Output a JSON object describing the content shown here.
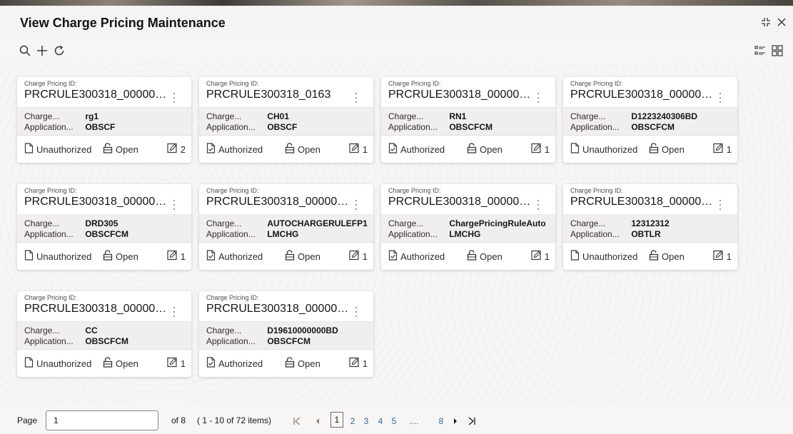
{
  "header": {
    "title": "View Charge Pricing Maintenance",
    "minimize_icon": "compress-icon",
    "close_icon": "close-icon"
  },
  "toolbar": {
    "icons": [
      "search-icon",
      "add-icon",
      "refresh-icon"
    ],
    "view_icons": [
      "list-view-icon",
      "tile-view-icon"
    ]
  },
  "card_labels": {
    "id_label": "Charge Pricing ID:",
    "charge_key": "Charge...",
    "application_key": "Application..."
  },
  "cards": [
    {
      "id": "PRCRULE300318_000000...",
      "charge": "rg1",
      "application": "OBSCF",
      "status": "Unauthorized",
      "lock": "Open",
      "mods": "2"
    },
    {
      "id": "PRCRULE300318_0163",
      "charge": "CH01",
      "application": "OBSCF",
      "status": "Authorized",
      "lock": "Open",
      "mods": "1"
    },
    {
      "id": "PRCRULE300318_000000...",
      "charge": "RN1",
      "application": "OBSCFCM",
      "status": "Authorized",
      "lock": "Open",
      "mods": "1"
    },
    {
      "id": "PRCRULE300318_000000...",
      "charge": "D1223240306BD",
      "application": "OBSCFCM",
      "status": "Unauthorized",
      "lock": "Open",
      "mods": "1"
    },
    {
      "id": "PRCRULE300318_000000...",
      "charge": "DRD305",
      "application": "OBSCFCM",
      "status": "Unauthorized",
      "lock": "Open",
      "mods": "1"
    },
    {
      "id": "PRCRULE300318_000000...",
      "charge": "AUTOCHARGERULEFP1",
      "application": "LMCHG",
      "status": "Authorized",
      "lock": "Open",
      "mods": "1"
    },
    {
      "id": "PRCRULE300318_000000...",
      "charge": "ChargePricingRuleAuto",
      "application": "LMCHG",
      "status": "Authorized",
      "lock": "Open",
      "mods": "1"
    },
    {
      "id": "PRCRULE300318_000000...",
      "charge": "12312312",
      "application": "OBTLR",
      "status": "Unauthorized",
      "lock": "Open",
      "mods": "1"
    },
    {
      "id": "PRCRULE300318_000000...",
      "charge": "CC",
      "application": "OBSCFCM",
      "status": "Unauthorized",
      "lock": "Open",
      "mods": "1"
    },
    {
      "id": "PRCRULE300318_000000...",
      "charge": "D19610000000BD",
      "application": "OBSCFCM",
      "status": "Authorized",
      "lock": "Open",
      "mods": "1"
    }
  ],
  "pagination": {
    "page_label": "Page",
    "page_value": "1",
    "of_label": "of 8",
    "items_label": "( 1 - 10 of 72 items)",
    "first_icon": "|<",
    "prev_icon": "◂",
    "pages": [
      "1",
      "2",
      "3",
      "4",
      "5",
      "....",
      "8"
    ],
    "next_icon": "▸",
    "last_icon": ">|"
  },
  "colors": {
    "background": "#f7f6f4",
    "card": "#ffffff",
    "card_band": "#f1efed",
    "link": "#2b6ca3",
    "text": "#161513"
  }
}
